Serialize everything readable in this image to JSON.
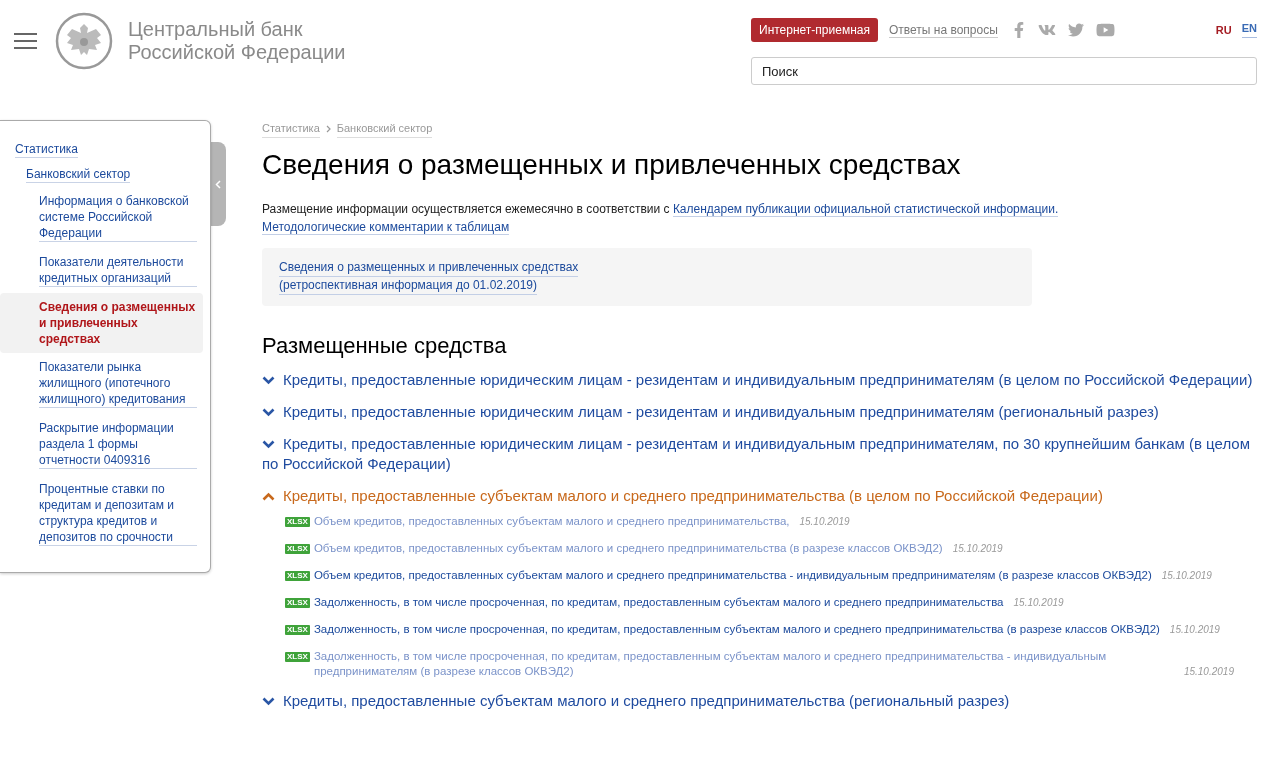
{
  "header": {
    "logo_lines": [
      "Центральный банк",
      "Российской Федерации"
    ],
    "reception_button": "Интернет-приемная",
    "faq_link": "Ответы на вопросы",
    "languages": [
      {
        "label": "RU",
        "selected": true
      },
      {
        "label": "EN",
        "selected": false
      }
    ],
    "search": {
      "placeholder": "Поиск"
    }
  },
  "sidebar": {
    "items": [
      {
        "label": "Статистика",
        "selected": false,
        "children": [
          {
            "label": "Банковский сектор",
            "selected": false,
            "children": [
              {
                "label": "Информация о банковской системе Российской Федерации",
                "selected": false
              },
              {
                "label": "Показатели деятельности кредитных организаций",
                "selected": false
              },
              {
                "label": "Сведения о размещенных и привлеченных средствах",
                "selected": true
              },
              {
                "label": "Показатели рынка жилищного (ипотечного жилищного) кредитования",
                "selected": false
              },
              {
                "label": "Раскрытие информации раздела 1 формы отчетности 0409316",
                "selected": false
              },
              {
                "label": "Процентные ставки по кредитам и депозитам и структура кредитов и депозитов по срочности",
                "selected": false
              }
            ]
          }
        ]
      }
    ]
  },
  "breadcrumbs": [
    "Статистика",
    "Банковский сектор"
  ],
  "title": "Сведения о размещенных и привлеченных средствах",
  "intro": {
    "text": "Размещение информации осуществляется ежемесячно в соответствии с",
    "link": "Календарем публикации официальной статистической информации.",
    "link2": "Методологические комментарии к таблицам"
  },
  "retro_box": {
    "lines": [
      "Сведения о размещенных и привлеченных средствах",
      "(ретроспективная информация до 01.02.2019)"
    ]
  },
  "section": {
    "heading": "Размещенные средства",
    "items": [
      {
        "title": "Кредиты, предоставленные юридическим лицам - резидентам и индивидуальным предпринимателям (в целом по Российской Федерации)",
        "expanded": false
      },
      {
        "title": "Кредиты, предоставленные юридическим лицам - резидентам и индивидуальным предпринимателям (региональный разрез)",
        "expanded": false
      },
      {
        "title": "Кредиты, предоставленные юридическим лицам - резидентам и индивидуальным предпринимателям, по 30 крупнейшим банкам (в целом по Российской Федерации)",
        "expanded": false
      },
      {
        "title": "Кредиты, предоставленные субъектам малого и среднего предпринимательства (в целом по Российской Федерации)",
        "expanded": true,
        "files": [
          {
            "type": "XLSX",
            "title": "Объем кредитов, предоставленных субъектам малого и среднего предпринимательства,",
            "date": "15.10.2019",
            "visited": true
          },
          {
            "type": "XLSX",
            "title": "Объем кредитов, предоставленных субъектам малого и среднего предпринимательства (в разрезе классов ОКВЭД2)",
            "date": "15.10.2019",
            "visited": true
          },
          {
            "type": "XLSX",
            "title": "Объем кредитов, предоставленных субъектам малого и среднего предпринимательства - индивидуальным предпринимателям (в разрезе классов ОКВЭД2)",
            "date": "15.10.2019",
            "visited": false
          },
          {
            "type": "XLSX",
            "title": "Задолженность, в том числе просроченная, по кредитам, предоставленным субъектам малого и среднего предпринимательства",
            "date": "15.10.2019",
            "visited": false
          },
          {
            "type": "XLSX",
            "title": "Задолженность, в том числе просроченная, по кредитам, предоставленным субъектам малого и среднего предпринимательства (в разрезе классов ОКВЭД2)",
            "date": "15.10.2019",
            "visited": false
          },
          {
            "type": "XLSX",
            "title": "Задолженность, в том числе просроченная, по кредитам, предоставленным субъектам малого и среднего предпринимательства - индивидуальным предпринимателям (в разрезе классов ОКВЭД2)",
            "date": "15.10.2019",
            "visited": true
          }
        ]
      },
      {
        "title": "Кредиты, предоставленные субъектам малого и среднего предпринимательства (региональный разрез)",
        "expanded": false
      }
    ]
  }
}
